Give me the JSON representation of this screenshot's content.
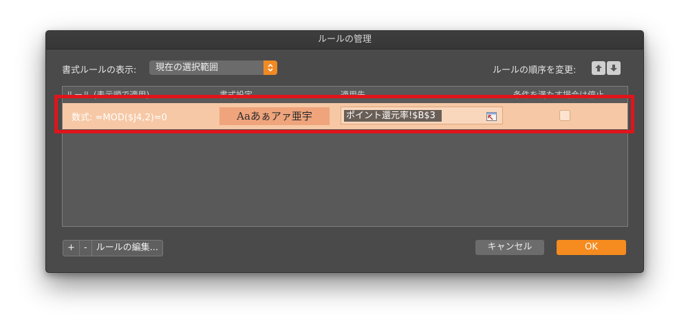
{
  "dialog": {
    "title": "ルールの管理",
    "show_rules_label": "書式ルールの表示:",
    "scope_value": "現在の選択範囲",
    "order_label": "ルールの順序を変更:"
  },
  "table": {
    "columns": [
      "ルール (表示順で適用)",
      "書式設定",
      "適用先",
      "条件を満たす場合は停止"
    ],
    "rows": [
      {
        "condition": "数式: =MOD($J4,2)=0",
        "preview": "Aaあぁアァ亜宇",
        "applies_to": "ポイント還元率!$B$3",
        "stop_if_true": false
      }
    ]
  },
  "footer": {
    "add_label": "+",
    "remove_label": "-",
    "edit_label": "ルールの編集...",
    "cancel_label": "キャンセル",
    "ok_label": "OK"
  },
  "colors": {
    "accent": "#f68b1f",
    "highlight": "#e0151b",
    "row_bg": "#f6c8a5"
  }
}
